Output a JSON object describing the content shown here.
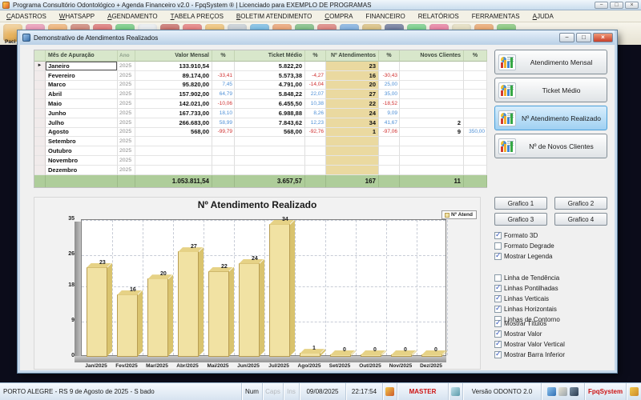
{
  "window": {
    "title": "Programa Consultório Odontológico + Agenda Financeiro v2.0 - FpqSystem ® | Licenciado para  EXEMPLO DE PROGRAMAS",
    "minimize_label": "−",
    "maximize_label": "□",
    "close_label": "×"
  },
  "menu": {
    "items": [
      "CADASTROS",
      "WHATSAPP",
      "AGENDAMENTO",
      "TABELA PREÇOS",
      "BOLETIM ATENDIMENTO",
      "COMPRA",
      "FINANCEIRO",
      "RELATÓRIOS",
      "FERRAMENTAS",
      "AJUDA"
    ],
    "underline_first": [
      true,
      true,
      true,
      true,
      true,
      true,
      false,
      false,
      false,
      true
    ]
  },
  "toolbar": {
    "first_label": "Paci",
    "icons": [
      {
        "name": "patients-icon",
        "color": "#e7b25c"
      },
      {
        "name": "birthday-icon",
        "color": "#e06c96"
      },
      {
        "name": "professional-icon",
        "color": "#e8923c"
      },
      {
        "name": "couple-icon",
        "color": "#b8503c"
      },
      {
        "name": "schedule-icon",
        "color": "#cc3a3a"
      },
      {
        "name": "whatsapp-icon",
        "color": "#35b44a"
      },
      {
        "name": "document-icon",
        "color": "#dfe5ea"
      },
      {
        "name": "certificate-icon",
        "color": "#b03028"
      },
      {
        "name": "attendance-icon",
        "color": "#d84444"
      },
      {
        "name": "folder-icon",
        "color": "#e8a83c"
      },
      {
        "name": "receipts-icon",
        "color": "#aeb9c2"
      },
      {
        "name": "lab-icon",
        "color": "#3f9fd8"
      },
      {
        "name": "calendar-day-icon",
        "color": "#e07a36"
      },
      {
        "name": "calendar-ok-icon",
        "color": "#44a04c"
      },
      {
        "name": "calendar-cancel-icon",
        "color": "#cc4c44"
      },
      {
        "name": "statistics-icon",
        "color": "#4a8ed2"
      },
      {
        "name": "payments-icon",
        "color": "#c8a448"
      },
      {
        "name": "wallet-icon",
        "color": "#2e3e6e"
      },
      {
        "name": "income-icon",
        "color": "#3bba55"
      },
      {
        "name": "expense-icon",
        "color": "#de4878"
      },
      {
        "name": "cards-icon",
        "color": "#d8cfa4"
      },
      {
        "name": "commission-icon",
        "color": "#e08030"
      },
      {
        "name": "video-icon",
        "color": "#50b043"
      }
    ]
  },
  "inner_window": {
    "title": "Demonstrativo de Atendimentos Realizados",
    "minimize_label": "−",
    "maximize_label": "□",
    "close_label": "×"
  },
  "table": {
    "headers": [
      "Mês de Apuração",
      "Ano",
      "Valor Mensal",
      "%",
      "Ticket Médio",
      "%",
      "Nº Atendimentos",
      "%",
      "Novos Clientes",
      "%"
    ],
    "rows": [
      [
        "Janeiro",
        "2025",
        "133.910,54",
        "",
        "5.822,20",
        "",
        "23",
        "",
        "",
        ""
      ],
      [
        "Fevereiro",
        "2025",
        "89.174,00",
        "-33,41",
        "5.573,38",
        "-4,27",
        "16",
        "-30,43",
        "",
        ""
      ],
      [
        "Marco",
        "2025",
        "95.820,00",
        "7,45",
        "4.791,00",
        "-14,04",
        "20",
        "25,00",
        "",
        ""
      ],
      [
        "Abril",
        "2025",
        "157.902,00",
        "64,79",
        "5.848,22",
        "22,07",
        "27",
        "35,00",
        "",
        ""
      ],
      [
        "Maio",
        "2025",
        "142.021,00",
        "-10,06",
        "6.455,50",
        "10,38",
        "22",
        "-18,52",
        "",
        ""
      ],
      [
        "Junho",
        "2025",
        "167.733,00",
        "18,10",
        "6.988,88",
        "8,26",
        "24",
        "9,09",
        "",
        ""
      ],
      [
        "Julho",
        "2025",
        "266.683,00",
        "58,99",
        "7.843,62",
        "12,23",
        "34",
        "41,67",
        "2",
        ""
      ],
      [
        "Agosto",
        "2025",
        "568,00",
        "-99,79",
        "568,00",
        "-92,76",
        "1",
        "-97,06",
        "9",
        "350,00"
      ],
      [
        "Setembro",
        "2025",
        "",
        "",
        "",
        "",
        "",
        "",
        "",
        ""
      ],
      [
        "Outubro",
        "2025",
        "",
        "",
        "",
        "",
        "",
        "",
        "",
        ""
      ],
      [
        "Novembro",
        "2025",
        "",
        "",
        "",
        "",
        "",
        "",
        "",
        ""
      ],
      [
        "Dezembro",
        "2025",
        "",
        "",
        "",
        "",
        "",
        "",
        "",
        ""
      ]
    ],
    "totals": [
      "",
      "",
      "1.053.811,54",
      "",
      "3.657,57",
      "",
      "167",
      "",
      "11",
      ""
    ],
    "selected_row_marker": "►"
  },
  "side_buttons": [
    {
      "label": "Atendimento Mensal",
      "active": false
    },
    {
      "label": "Ticket Médio",
      "active": false
    },
    {
      "label": "Nº Atendimento Realizado",
      "active": true
    },
    {
      "label": "Nº de Novos Clientes",
      "active": false
    }
  ],
  "grafico_buttons": [
    "Grafico 1",
    "Grafico 2",
    "Grafico 3",
    "Grafico 4"
  ],
  "checkbox_groups": [
    [
      {
        "label": "Formato 3D",
        "checked": true
      },
      {
        "label": "Formato Degrade",
        "checked": false
      },
      {
        "label": "Mostrar Legenda",
        "checked": true
      }
    ],
    [
      {
        "label": "Linha de Tendência",
        "checked": false
      },
      {
        "label": "Linhas Pontilhadas",
        "checked": true
      },
      {
        "label": "Linhas Verticais",
        "checked": true
      },
      {
        "label": "Linhas Horizontais",
        "checked": true
      },
      {
        "label": "Linhas de Contorno",
        "checked": false
      }
    ],
    [
      {
        "label": "Mostrar Títulos",
        "checked": true
      },
      {
        "label": "Mostrar Valor",
        "checked": true
      },
      {
        "label": "Mostrar Valor Vertical",
        "checked": true
      },
      {
        "label": "Mostrar Barra Inferior",
        "checked": true
      }
    ]
  ],
  "chart_data": {
    "type": "bar",
    "title": "Nº Atendimento Realizado",
    "categories": [
      "Jan/2025",
      "Fev/2025",
      "Mar/2025",
      "Abr/2025",
      "Mai/2025",
      "Jun/2025",
      "Jul/2025",
      "Ago/2025",
      "Set/2025",
      "Out/2025",
      "Nov/2025",
      "Dez/2025"
    ],
    "series": [
      {
        "name": "Nº Atend",
        "values": [
          23,
          16,
          20,
          27,
          22,
          24,
          34,
          1,
          0,
          0,
          0,
          0
        ]
      }
    ],
    "xlabel": "",
    "ylabel": "",
    "ylim": [
      0,
      35
    ],
    "yticks": [
      0,
      9,
      18,
      26,
      35
    ],
    "grid": true,
    "style_3d": true,
    "legend_position": "top-right",
    "bar_color": "#f1e2a3"
  },
  "colors": {
    "negative_pct": "#d03030",
    "positive_pct": "#4d8fd6",
    "highlight_column": "#ead9a0",
    "header_green": "#d8e7cb",
    "totals_green": "#aecd9a",
    "active_button_blue": "#9fd0f2",
    "bar_fill": "#f1e2a3"
  },
  "statusbar": {
    "location": "PORTO ALEGRE - RS  9 de Agosto de 2025 - S bado",
    "num_label": "Num",
    "caps_label": "Caps",
    "ins_label": "Ins",
    "date": "09/08/2025",
    "time": "22:17:54",
    "user": "MASTER",
    "version": "Versão ODONTO 2.0",
    "brand": "FpqSystem"
  }
}
